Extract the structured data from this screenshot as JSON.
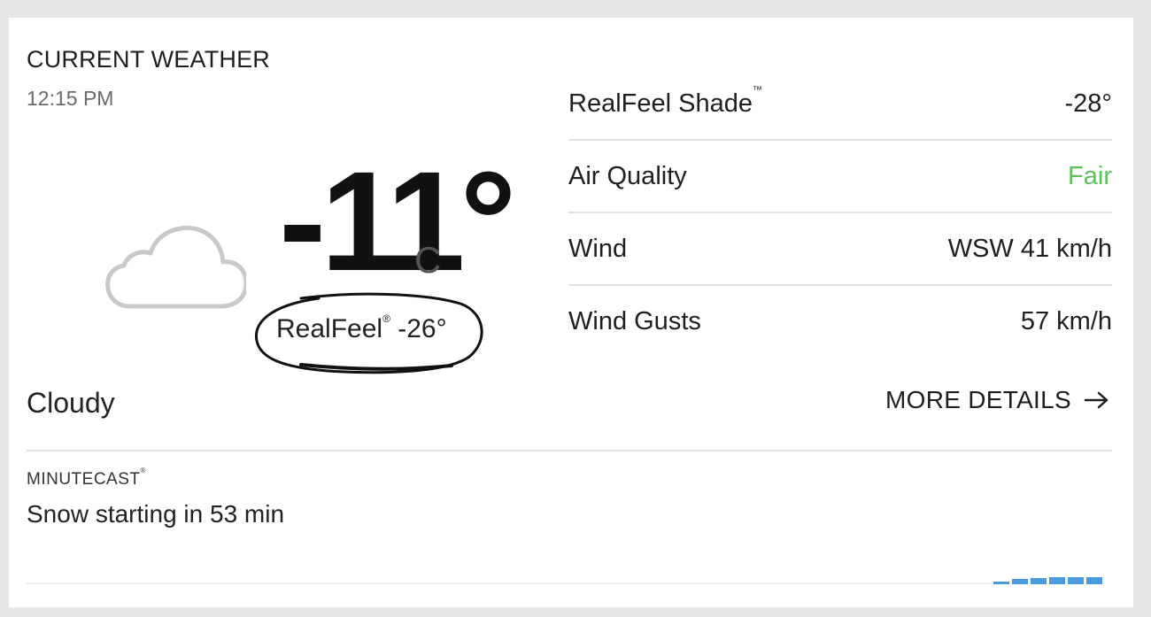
{
  "header": {
    "title": "CURRENT WEATHER",
    "time": "12:15 PM"
  },
  "current": {
    "icon": "cloud-icon",
    "temperature": "-11°",
    "unit": "C",
    "realfeel_label": "RealFeel",
    "realfeel_mark": "®",
    "realfeel_value": "-26°",
    "condition": "Cloudy"
  },
  "details": [
    {
      "label": "RealFeel Shade",
      "mark": "™",
      "value": "-28°"
    },
    {
      "label": "Air Quality",
      "value": "Fair",
      "value_color": "#5cc05e"
    },
    {
      "label": "Wind",
      "value": "WSW 41 km/h"
    },
    {
      "label": "Wind Gusts",
      "value": "57 km/h"
    }
  ],
  "more_details": {
    "label": "MORE DETAILS",
    "icon": "arrow-right-icon"
  },
  "minutecast": {
    "label": "MINUTECAST",
    "mark": "®",
    "text": "Snow starting in 53 min",
    "bar_color": "#4a9be0"
  }
}
